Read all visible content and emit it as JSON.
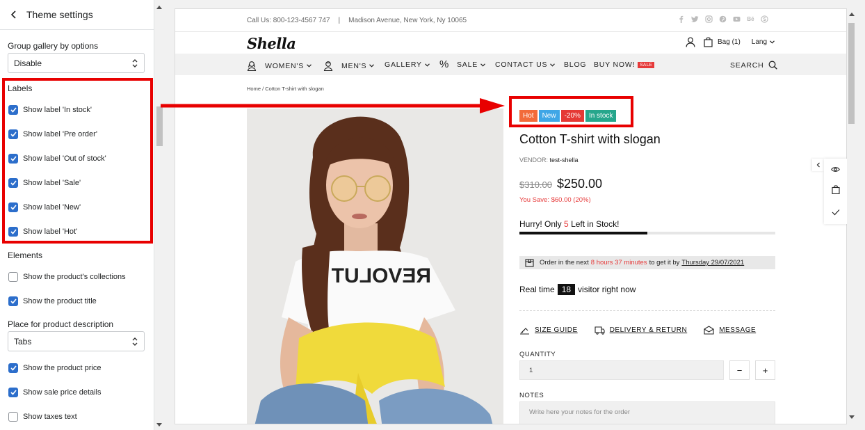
{
  "sidebar": {
    "title": "Theme settings",
    "group_gallery": {
      "label": "Group gallery by options",
      "value": "Disable"
    },
    "labels_heading": "Labels",
    "labels": [
      {
        "text": "Show label 'In stock'",
        "checked": true
      },
      {
        "text": "Show label 'Pre order'",
        "checked": true
      },
      {
        "text": "Show label 'Out of stock'",
        "checked": true
      },
      {
        "text": "Show label 'Sale'",
        "checked": true
      },
      {
        "text": "Show label 'New'",
        "checked": true
      },
      {
        "text": "Show label 'Hot'",
        "checked": true
      }
    ],
    "elements_heading": "Elements",
    "elements": [
      {
        "text": "Show the product's collections",
        "checked": false
      },
      {
        "text": "Show the product title",
        "checked": true
      }
    ],
    "description_place": {
      "label": "Place for product description",
      "value": "Tabs"
    },
    "price_options": [
      {
        "text": "Show the product price",
        "checked": true
      },
      {
        "text": "Show sale price details",
        "checked": true
      },
      {
        "text": "Show taxes text",
        "checked": false
      }
    ]
  },
  "store": {
    "topbar": {
      "phone": "Call Us: 800-123-4567 747",
      "separator": "|",
      "address": "Madison Avenue, New York, Ny 10065"
    },
    "logo": "Shella",
    "header": {
      "bag": "Bag (1)",
      "lang": "Lang"
    },
    "nav": {
      "womens": "WOMEN'S",
      "mens": "MEN'S",
      "gallery": "GALLERY",
      "percent": "%",
      "sale": "SALE",
      "contact": "CONTACT US",
      "blog": "BLOG",
      "buy_now": "BUY NOW!",
      "sale_badge": "SALE",
      "search": "SEARCH"
    },
    "breadcrumb": "Home  /  Cotton T-shirt with slogan",
    "badges": [
      {
        "text": "Hot",
        "color": "#f26b3a"
      },
      {
        "text": "New",
        "color": "#3fa6e6"
      },
      {
        "text": "-20%",
        "color": "#e53935"
      },
      {
        "text": "In stock",
        "color": "#26a68c"
      }
    ],
    "product": {
      "title": "Cotton T-shirt with slogan",
      "vendor_label": "VENDOR:",
      "vendor": "test-shella",
      "old_price": "$310.00",
      "price": "$250.00",
      "you_save": "You Save: $60.00 (20%)",
      "hurry_prefix": "Hurry! Only",
      "hurry_count": "5",
      "hurry_suffix": "Left in Stock!",
      "stock_fraction": 0.5,
      "order_prefix": "Order in the next",
      "order_time": "8 hours 37 minutes",
      "order_mid": "to get it by",
      "order_date": "Thursday 29/07/2021",
      "realtime_prefix": "Real time",
      "realtime_count": "18",
      "realtime_suffix": "visitor right now",
      "size_guide": "SIZE GUIDE",
      "delivery": "DELIVERY & RETURN",
      "message": "MESSAGE",
      "quantity_label": "QUANTITY",
      "quantity_value": "1",
      "minus": "−",
      "plus": "+",
      "notes_label": "NOTES",
      "notes_placeholder": "Write here your notes for the order",
      "tshirt_text": "REVOLUT"
    }
  },
  "colors": {
    "accent_red": "#e80000",
    "checkbox_blue": "#2c6ecb"
  }
}
